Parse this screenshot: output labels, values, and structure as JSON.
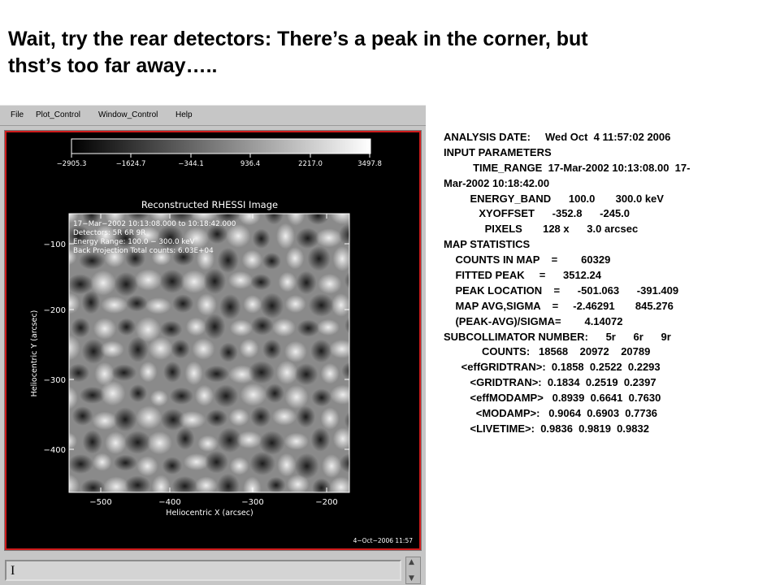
{
  "slide": {
    "title_line1": "Wait, try the rear detectors: There’s a peak in the corner, but",
    "title_line2": "thst’s too far away….."
  },
  "window": {
    "menu": [
      "File",
      "Plot_Control",
      "Window_Control",
      "Help"
    ],
    "command_value": "I"
  },
  "plot": {
    "colorbar_ticks": [
      "−2905.3",
      "−1624.7",
      "−344.1",
      "936.4",
      "2217.0",
      "3497.8"
    ],
    "title": "Reconstructed RHESSI Image",
    "info": [
      "17−Mar−2002 10:13:08.000 to 10:18:42.000",
      "Detectors: 5R 6R   9R",
      "Energy Range: 100.0 − 300.0 keV",
      "Back Projection      Total counts: 6.03E+04"
    ],
    "y_label": "Heliocentric Y (arcsec)",
    "x_label": "Heliocentric X (arcsec)",
    "y_ticks": [
      "−100",
      "−200",
      "−300",
      "−400"
    ],
    "x_ticks": [
      "−500",
      "−400",
      "−300",
      "−200"
    ],
    "timestamp": "4−Oct−2006 11:57",
    "colors": {
      "frame": "#d01c1c",
      "background": "#000000",
      "text": "#ffffff"
    }
  },
  "stats": {
    "lines": [
      "ANALYSIS DATE:     Wed Oct  4 11:57:02 2006",
      "INPUT PARAMETERS",
      "          TIME_RANGE  17-Mar-2002 10:13:08.00  17-",
      "Mar-2002 10:18:42.00",
      "         ENERGY_BAND      100.0       300.0 keV",
      "            XYOFFSET      -352.8      -245.0",
      "              PIXELS       128 x      3.0 arcsec",
      "MAP STATISTICS",
      "    COUNTS IN MAP    =        60329",
      "    FITTED PEAK     =      3512.24",
      "    PEAK LOCATION    =      -501.063      -391.409",
      "    MAP AVG,SIGMA    =     -2.46291       845.276",
      "    (PEAK-AVG)/SIGMA=        4.14072",
      "SUBCOLLIMATOR NUMBER:      5r      6r      9r",
      "             COUNTS:   18568    20972    20789",
      "      <effGRIDTRAN>:  0.1858  0.2522  0.2293",
      "         <GRIDTRAN>:  0.1834  0.2519  0.2397",
      "         <effMODAMP>   0.8939  0.6641  0.7630",
      "           <MODAMP>:   0.9064  0.6903  0.7736",
      "         <LIVETIME>:  0.9836  0.9819  0.9832"
    ]
  }
}
